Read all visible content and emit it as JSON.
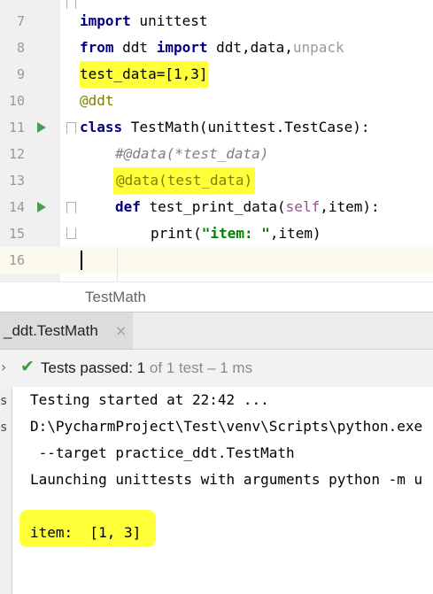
{
  "editor": {
    "lines": [
      {
        "num": "7",
        "text": "import unittest"
      },
      {
        "num": "8",
        "text": "from ddt import ddt,data,unpack"
      },
      {
        "num": "9",
        "text": "test_data=[1,3]"
      },
      {
        "num": "10",
        "text": "@ddt"
      },
      {
        "num": "11",
        "text": "class TestMath(unittest.TestCase):"
      },
      {
        "num": "12",
        "text": "#@data(*test_data)"
      },
      {
        "num": "13",
        "text": "@data(test_data)"
      },
      {
        "num": "14",
        "text": "def test_print_data(self,item):"
      },
      {
        "num": "15",
        "text": "print(\"item: \",item)"
      },
      {
        "num": "16",
        "text": ""
      }
    ],
    "tokens": {
      "l7_kw": "import",
      "l7_rest": " unittest",
      "l8_kw1": "from",
      "l8_mid": " ddt ",
      "l8_kw2": "import",
      "l8_rest": " ddt,data,",
      "l8_unused": "unpack",
      "l9": "test_data=[1,3]",
      "l10": "@ddt",
      "l11_kw": "class",
      "l11_rest": " TestMath(unittest.TestCase):",
      "l12": "#@data(*test_data)",
      "l13": "@data(test_data)",
      "l14_kw": "def",
      "l14_name": " test_print_data(",
      "l14_self": "self",
      "l14_rest": ",item):",
      "l15_a": "print(",
      "l15_str": "\"item: \"",
      "l15_b": ",item)"
    }
  },
  "breadcrumb": {
    "label": "TestMath"
  },
  "run_tab": {
    "label": "_ddt.TestMath",
    "close": "×"
  },
  "status": {
    "prefix": "Tests passed: ",
    "passed": "1",
    "rest": " of 1 test – 1 ms"
  },
  "console": {
    "gutter": [
      "s",
      "s"
    ],
    "lines": [
      "Testing started at 22:42 ...",
      "D:\\PycharmProject\\Test\\venv\\Scripts\\python.exe",
      " --target practice_ddt.TestMath",
      "Launching unittests with arguments python -m u",
      "",
      "item:  [1, 3]"
    ]
  },
  "colors": {
    "highlight": "#ffff3a",
    "run_green": "#499c54",
    "keyword": "#000080",
    "decorator": "#808000"
  },
  "icons": [
    "run-test-icon",
    "fold-icon",
    "close-icon",
    "chevron-right-icon",
    "check-icon"
  ]
}
